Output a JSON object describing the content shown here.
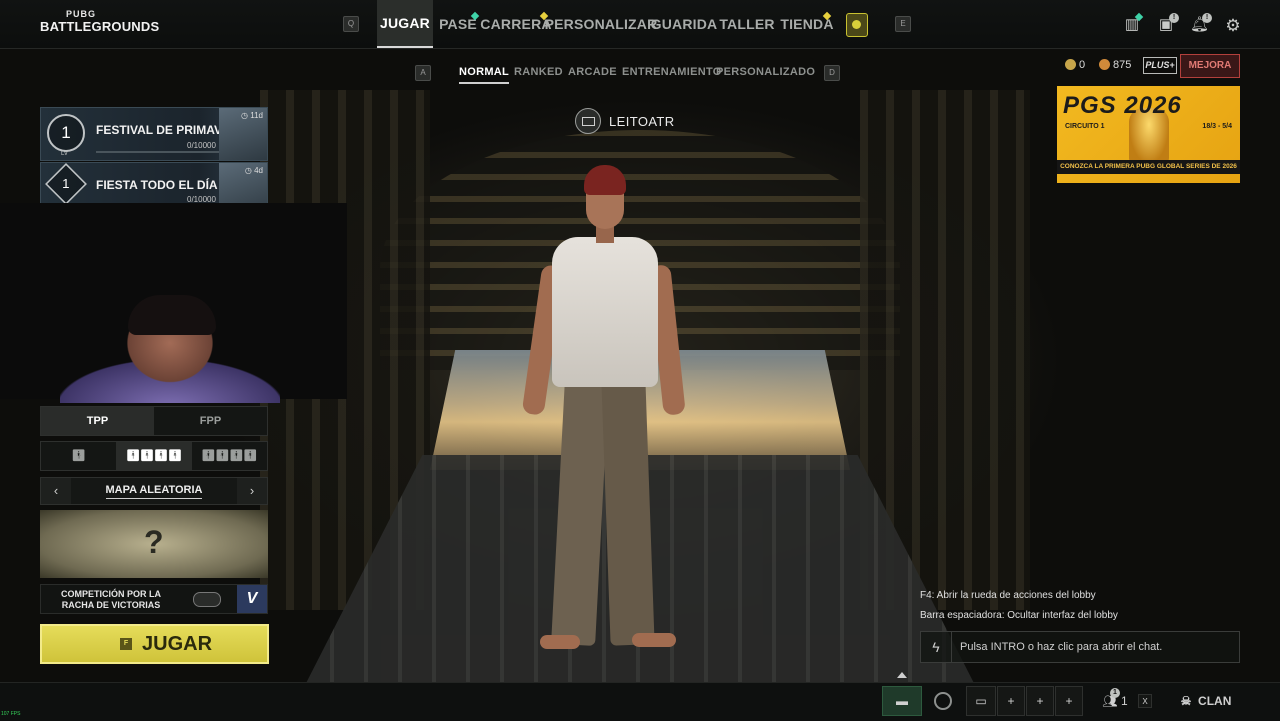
{
  "logo": {
    "top": "PUBG",
    "bottom": "BATTLEGROUNDS"
  },
  "top_nav": {
    "key_left": "Q",
    "key_right": "E",
    "items": [
      {
        "label": "JUGAR",
        "active": true,
        "dot": null
      },
      {
        "label": "PASE",
        "active": false,
        "dot": "green"
      },
      {
        "label": "CARRERA",
        "active": false,
        "dot": "yellow"
      },
      {
        "label": "PERSONALIZAR",
        "active": false,
        "dot": null
      },
      {
        "label": "GUARIDA",
        "active": false,
        "dot": null
      },
      {
        "label": "TALLER",
        "active": false,
        "dot": null
      },
      {
        "label": "TIENDA",
        "active": false,
        "dot": "yellow"
      }
    ],
    "icons": [
      "shop-icon",
      "gift-icon",
      "bell-icon",
      "gear-icon"
    ],
    "badges": {
      "gift": "!",
      "bell": "!"
    }
  },
  "sub_nav": {
    "key_left": "A",
    "key_right": "D",
    "items": [
      {
        "label": "NORMAL",
        "active": true
      },
      {
        "label": "RANKED",
        "active": false
      },
      {
        "label": "ARCADE",
        "active": false
      },
      {
        "label": "ENTRENAMIENTO",
        "active": false
      },
      {
        "label": "PERSONALIZADO",
        "active": false
      }
    ]
  },
  "currency": {
    "gcoin": "0",
    "bp": "875",
    "plus_label": "PLUS+",
    "upgrade_label": "MEJORA"
  },
  "banner": {
    "title": "PGS 2026",
    "circuit": "CIRCUITO 1",
    "dates": "18/3 - 5/4",
    "caption": "CONOZCA LA PRIMERA PUBG GLOBAL SERIES DE 2026"
  },
  "player": {
    "name": "LEITOATR"
  },
  "events": [
    {
      "level": "1",
      "level_sub": "LV",
      "title": "FESTIVAL DE PRIMAVER...",
      "progress": "0/10000",
      "days": "11d"
    },
    {
      "level": "1",
      "level_sub": "",
      "title": "FIESTA TODO EL DÍA",
      "progress": "0/10000",
      "days": "4d"
    }
  ],
  "perspective": {
    "options": [
      "TPP",
      "FPP"
    ],
    "selected": "TPP"
  },
  "squad": {
    "options": [
      "solo",
      "squad-4",
      "squad-4-alt"
    ],
    "selected": "squad-4"
  },
  "map": {
    "label": "MAPA ALEATORIA",
    "prev": "‹",
    "next": "›",
    "preview_glyph": "?"
  },
  "streak": {
    "label": "COMPETICIÓN POR LA RACHA DE VICTORIAS",
    "badge": "V"
  },
  "play": {
    "key": "F",
    "label": "JUGAR"
  },
  "chat": {
    "lines": [
      "F4: Abrir la rueda de acciones del lobby",
      "Barra espaciadora: Ocultar interfaz del lobby"
    ],
    "placeholder": "Pulsa INTRO o haz clic para abrir el chat."
  },
  "bottom_bar": {
    "friends_count": "1",
    "friends_badge": "1",
    "clan_label": "CLAN",
    "x_label": "X",
    "plus": "+"
  },
  "fps": "107 FPS",
  "colors": {
    "play": "#d8cf44",
    "mejora": "#b3403c",
    "active_nav": "#ffffff"
  }
}
